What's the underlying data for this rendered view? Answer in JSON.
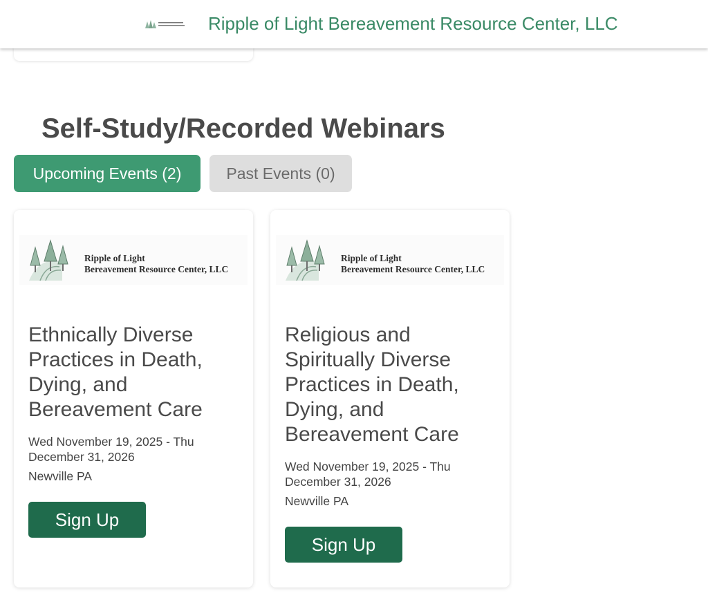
{
  "header": {
    "logo_icon": "ripple-of-light-logo-icon",
    "title": "Ripple of Light Bereavement Resource Center, LLC",
    "title_color": "#3a8a66"
  },
  "section": {
    "title": "Self-Study/Recorded Webinars"
  },
  "tabs": [
    {
      "label": "Upcoming Events (2)",
      "active": true,
      "color": "#3e9a72"
    },
    {
      "label": "Past Events (0)",
      "active": false,
      "color": "#dedede"
    }
  ],
  "events": [
    {
      "logo_line1": "Ripple of Light",
      "logo_line2": "Bereavement Resource Center, LLC",
      "title": "Ethnically Diverse Practices in Death, Dying, and Bereavement Care",
      "date": "Wed November 19, 2025 - Thu December 31, 2026",
      "location": "Newville PA",
      "button_label": "Sign Up"
    },
    {
      "logo_line1": "Ripple of Light",
      "logo_line2": "Bereavement Resource Center, LLC",
      "title": "Religious and Spiritually Diverse Practices in Death, Dying, and Bereavement Care",
      "date": "Wed November 19, 2025 - Thu December 31, 2026",
      "location": "Newville PA",
      "button_label": "Sign Up"
    }
  ],
  "colors": {
    "button": "#1f6b4c",
    "accent": "#3e9a72"
  }
}
